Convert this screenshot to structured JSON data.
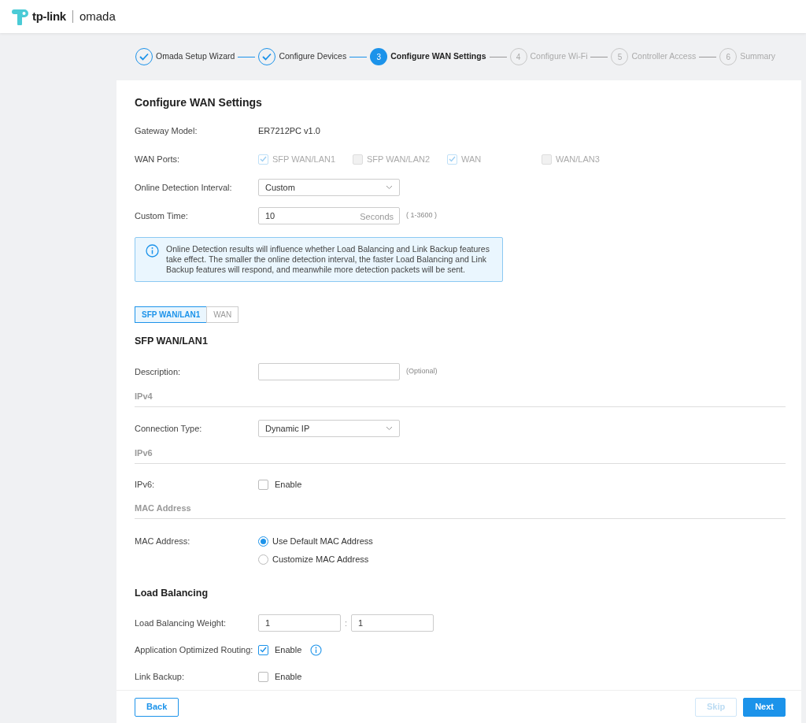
{
  "header": {
    "brand": "tp-link",
    "product": "omada"
  },
  "steps": [
    {
      "label": "Omada Setup Wizard",
      "completed": true,
      "selected": false
    },
    {
      "label": "Configure Devices",
      "completed": true,
      "selected": false
    },
    {
      "number": "3",
      "label": "Configure WAN Settings",
      "completed": false,
      "selected": true
    },
    {
      "number": "4",
      "label": "Configure Wi-Fi",
      "completed": false,
      "selected": false
    },
    {
      "number": "5",
      "label": "Controller Access",
      "completed": false,
      "selected": false
    },
    {
      "number": "6",
      "label": "Summary",
      "completed": false,
      "selected": false
    }
  ],
  "title": "Configure WAN Settings",
  "rows": [
    {
      "kind": "text",
      "label": "Gateway Model:",
      "value": "ER7212PC v1.0"
    },
    {
      "kind": "checkboxes",
      "label": "WAN Ports:",
      "options": [
        {
          "label": "SFP WAN/LAN1",
          "checked": true,
          "disabled": true
        },
        {
          "label": "SFP WAN/LAN2",
          "checked": false,
          "disabled": true
        },
        {
          "label": "WAN",
          "checked": true,
          "disabled": true
        },
        {
          "label": "WAN/LAN3",
          "checked": false,
          "disabled": true
        }
      ]
    },
    {
      "kind": "select",
      "label": "Online Detection Interval:",
      "value": "Custom"
    },
    {
      "kind": "input",
      "label": "Custom Time:",
      "value": "10",
      "unit": "Seconds",
      "hint": "( 1-3600 )"
    },
    {
      "kind": "alert",
      "text": "Online Detection results will influence whether Load Balancing and Link Backup features take effect. The smaller the online detection interval, the faster Load Balancing and Link Backup features will respond, and meanwhile more detection packets will be sent."
    },
    {
      "kind": "tabs",
      "tabs": [
        {
          "label": "SFP WAN/LAN1",
          "selected": true
        },
        {
          "label": "WAN",
          "selected": false
        }
      ]
    },
    {
      "kind": "heading",
      "text": "SFP WAN/LAN1"
    },
    {
      "kind": "input",
      "label": "Description:",
      "hint": "(Optional)"
    },
    {
      "kind": "subheading",
      "text": "IPv4"
    },
    {
      "kind": "select",
      "label": "Connection Type:",
      "value": "Dynamic IP"
    },
    {
      "kind": "subheading",
      "text": "IPv6"
    },
    {
      "kind": "checkbox",
      "label": "IPv6:",
      "option": {
        "label": "Enable",
        "checked": false
      }
    },
    {
      "kind": "subheading",
      "text": "MAC Address"
    },
    {
      "kind": "radios",
      "label": "MAC Address:",
      "options": [
        {
          "label": "Use Default MAC Address",
          "selected": true
        },
        {
          "label": "Customize MAC Address",
          "selected": false
        }
      ]
    },
    {
      "kind": "heading",
      "text": "Load Balancing"
    },
    {
      "kind": "pair",
      "label": "Load Balancing Weight:",
      "values": [
        "1",
        "1"
      ],
      "separator": ":"
    },
    {
      "kind": "checkbox",
      "label": "Application Optimized Routing:",
      "option": {
        "label": "Enable",
        "checked": true
      },
      "info": true
    },
    {
      "kind": "checkbox",
      "label": "Link Backup:",
      "option": {
        "label": "Enable",
        "checked": false
      }
    }
  ],
  "footer": {
    "buttons": [
      {
        "label": "Back",
        "kind": "outline",
        "disabled": false
      },
      {
        "label": "Skip",
        "kind": "outline",
        "disabled": true
      },
      {
        "label": "Next",
        "kind": "primary",
        "disabled": false
      }
    ]
  }
}
